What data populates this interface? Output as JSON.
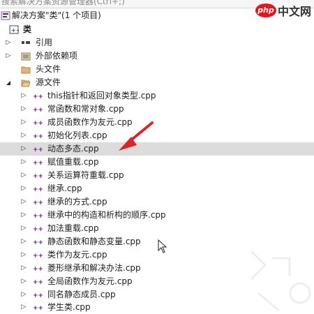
{
  "search": {
    "text": "搜索解决方案资源管理器(Ctrl+;)"
  },
  "solution": {
    "label": "解决方案\"类\"(1 个项目)"
  },
  "project": {
    "label": "类"
  },
  "folders": {
    "references": "引用",
    "external_deps": "外部依赖项",
    "header_files": "头文件",
    "source_files": "源文件"
  },
  "files": [
    {
      "name": "this指针和返回对象类型.cpp"
    },
    {
      "name": "常函数和常对象.cpp"
    },
    {
      "name": "成员函数作为友元.cpp"
    },
    {
      "name": "初始化列表.cpp"
    },
    {
      "name": "动态多态.cpp"
    },
    {
      "name": "赋值重载.cpp"
    },
    {
      "name": "关系运算符重载.cpp"
    },
    {
      "name": "继承.cpp"
    },
    {
      "name": "继承的方式.cpp"
    },
    {
      "name": "继承中的构造和析构的顺序.cpp"
    },
    {
      "name": "加法重载.cpp"
    },
    {
      "name": "静态函数和静态变量.cpp"
    },
    {
      "name": "类作为友元.cpp"
    },
    {
      "name": "菱形继承和解决办法.cpp"
    },
    {
      "name": "全局函数作为友元.cpp"
    },
    {
      "name": "同名静态成员.cpp"
    },
    {
      "name": "学生类.cpp"
    }
  ],
  "selected_file": "动态多态.cpp",
  "watermark": {
    "logo": "php",
    "text": "中文网"
  },
  "colors": {
    "selection": "#dcdcdc",
    "arrow": "#d9252a",
    "watermark_red": "#e8141b"
  }
}
